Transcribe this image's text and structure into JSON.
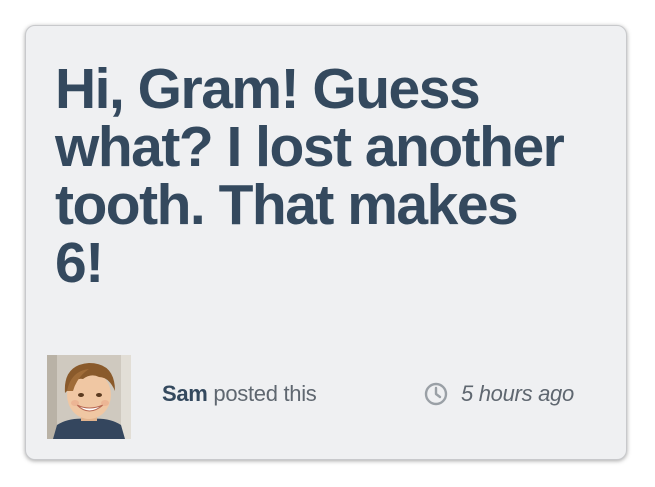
{
  "post": {
    "message": "Hi, Gram! Guess what? I lost another tooth. That makes 6!",
    "author_name": "Sam",
    "author_action": "posted this",
    "timestamp": "5 hours ago",
    "avatar_alt": "Photo of Sam",
    "clock_icon": "clock-icon"
  },
  "colors": {
    "card_background": "#eff0f2",
    "heading_text": "#34495e",
    "meta_text": "#5f6770"
  }
}
